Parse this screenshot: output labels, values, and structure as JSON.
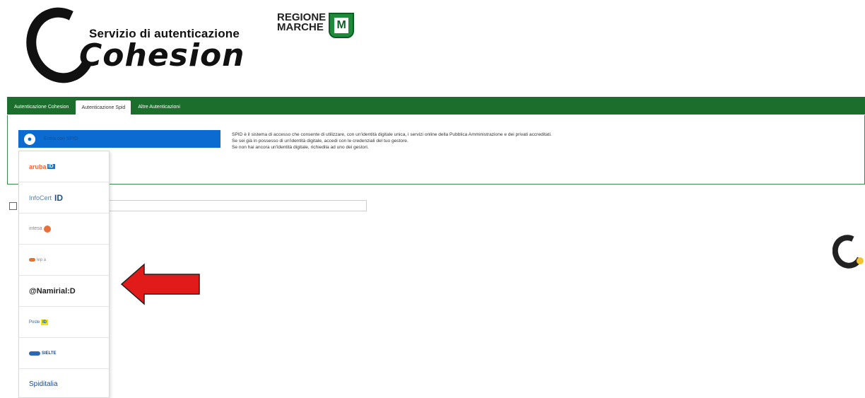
{
  "header": {
    "service_title": "Servizio di autenticazione",
    "brand_name": "Cohesion",
    "region_line1": "REGIONE",
    "region_line2": "MARCHE",
    "region_emblem": "M"
  },
  "tabs": [
    {
      "label": "Autenticazione Cohesion",
      "active": false
    },
    {
      "label": "Autenticazione Spid",
      "active": true
    },
    {
      "label": "Altre Autenticazioni",
      "active": false
    }
  ],
  "spid": {
    "button_label": "Entra con SPID",
    "button_icon": "user-icon",
    "info_lines": [
      "SPID è il sistema di accesso che consente di utilizzare, con un'identità digitale unica, i servizi online della Pubblica Amministrazione e dei privati accreditati.",
      "Se sei già in possesso di un'identità digitale, accedi con le credenziali del tuo gestore.",
      "Se non hai ancora un'identità digitale, richiedila ad uno dei gestori."
    ]
  },
  "providers": [
    {
      "name": "aruba",
      "badge": "ID"
    },
    {
      "name": "InfoCert",
      "badge": "ID"
    },
    {
      "name": "intesa",
      "badge": ""
    },
    {
      "name": "lep  a",
      "badge": ""
    },
    {
      "name": "@Namirial:D",
      "badge": ""
    },
    {
      "name": "Poste",
      "badge": "ID"
    },
    {
      "name": "SIELTE",
      "badge": ""
    },
    {
      "name": "Spiditalia",
      "badge": ""
    }
  ],
  "colors": {
    "tabbar": "#1b6e2c",
    "spid_button": "#0c6bd0",
    "arrow": "#e11a1a"
  }
}
